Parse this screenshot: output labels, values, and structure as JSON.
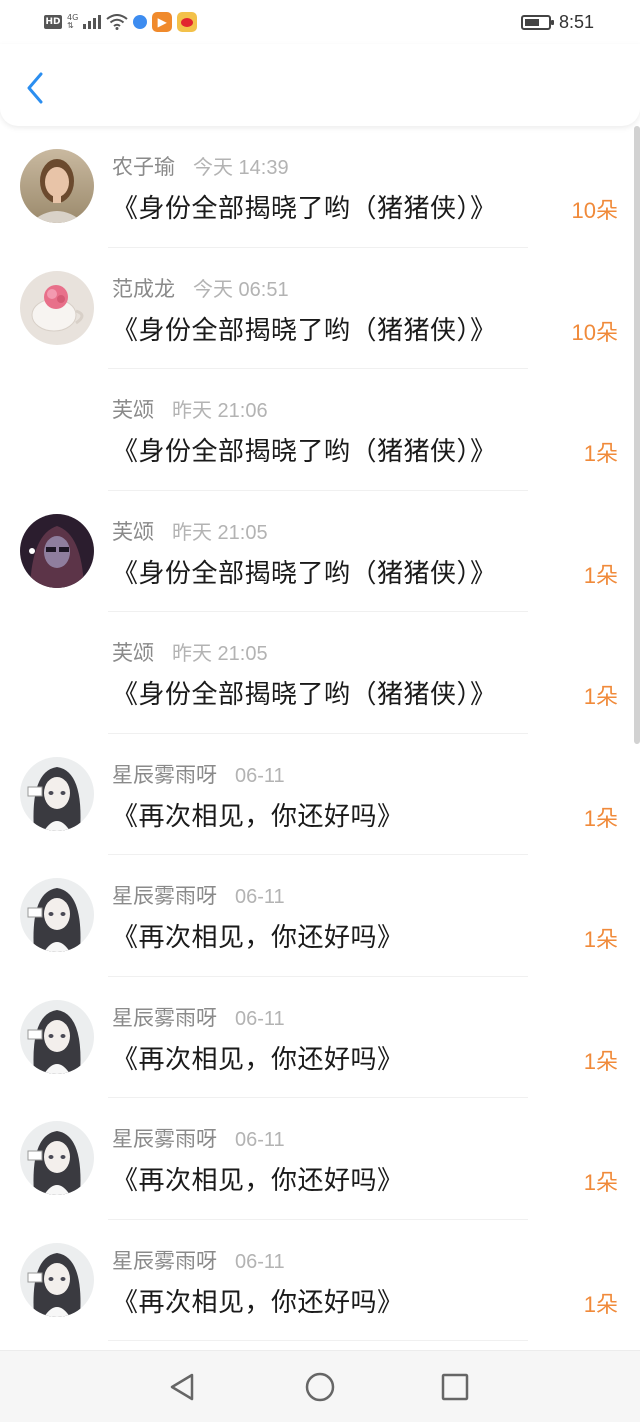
{
  "status_bar": {
    "hd_label": "HD",
    "network_label": "4G",
    "time": "8:51",
    "icons": [
      "signal-icon",
      "wifi-icon",
      "browser-icon",
      "video-app-icon",
      "weibo-icon",
      "battery-icon"
    ]
  },
  "header": {
    "back_icon": "chevron-left-icon"
  },
  "colors": {
    "accent": "#2b8ef0",
    "count": "#f08a3a",
    "name": "#8a8a8a",
    "time": "#b3b3b3"
  },
  "items": [
    {
      "avatar": "woman-photo",
      "name": "农子瑜",
      "time": "今天 14:39",
      "title": "《身份全部揭晓了哟（猪猪侠）》",
      "count": "10朵"
    },
    {
      "avatar": "flower-cup",
      "name": "范成龙",
      "time": "今天 06:51",
      "title": "《身份全部揭晓了哟（猪猪侠）》",
      "count": "10朵"
    },
    {
      "avatar": "",
      "name": "芙颂",
      "time": "昨天 21:06",
      "title": "《身份全部揭晓了哟（猪猪侠）》",
      "count": "1朵"
    },
    {
      "avatar": "dark-character",
      "name": "芙颂",
      "time": "昨天 21:05",
      "title": "《身份全部揭晓了哟（猪猪侠）》",
      "count": "1朵"
    },
    {
      "avatar": "",
      "name": "芙颂",
      "time": "昨天 21:05",
      "title": "《身份全部揭晓了哟（猪猪侠）》",
      "count": "1朵"
    },
    {
      "avatar": "anime-girl",
      "name": "星辰雾雨呀",
      "time": "06-11",
      "title": "《再次相见，你还好吗》",
      "count": "1朵"
    },
    {
      "avatar": "anime-girl",
      "name": "星辰雾雨呀",
      "time": "06-11",
      "title": "《再次相见，你还好吗》",
      "count": "1朵"
    },
    {
      "avatar": "anime-girl",
      "name": "星辰雾雨呀",
      "time": "06-11",
      "title": "《再次相见，你还好吗》",
      "count": "1朵"
    },
    {
      "avatar": "anime-girl",
      "name": "星辰雾雨呀",
      "time": "06-11",
      "title": "《再次相见，你还好吗》",
      "count": "1朵"
    },
    {
      "avatar": "anime-girl",
      "name": "星辰雾雨呀",
      "time": "06-11",
      "title": "《再次相见，你还好吗》",
      "count": "1朵"
    }
  ],
  "nav": {
    "buttons": [
      "back-triangle-icon",
      "home-circle-icon",
      "recents-square-icon"
    ]
  }
}
